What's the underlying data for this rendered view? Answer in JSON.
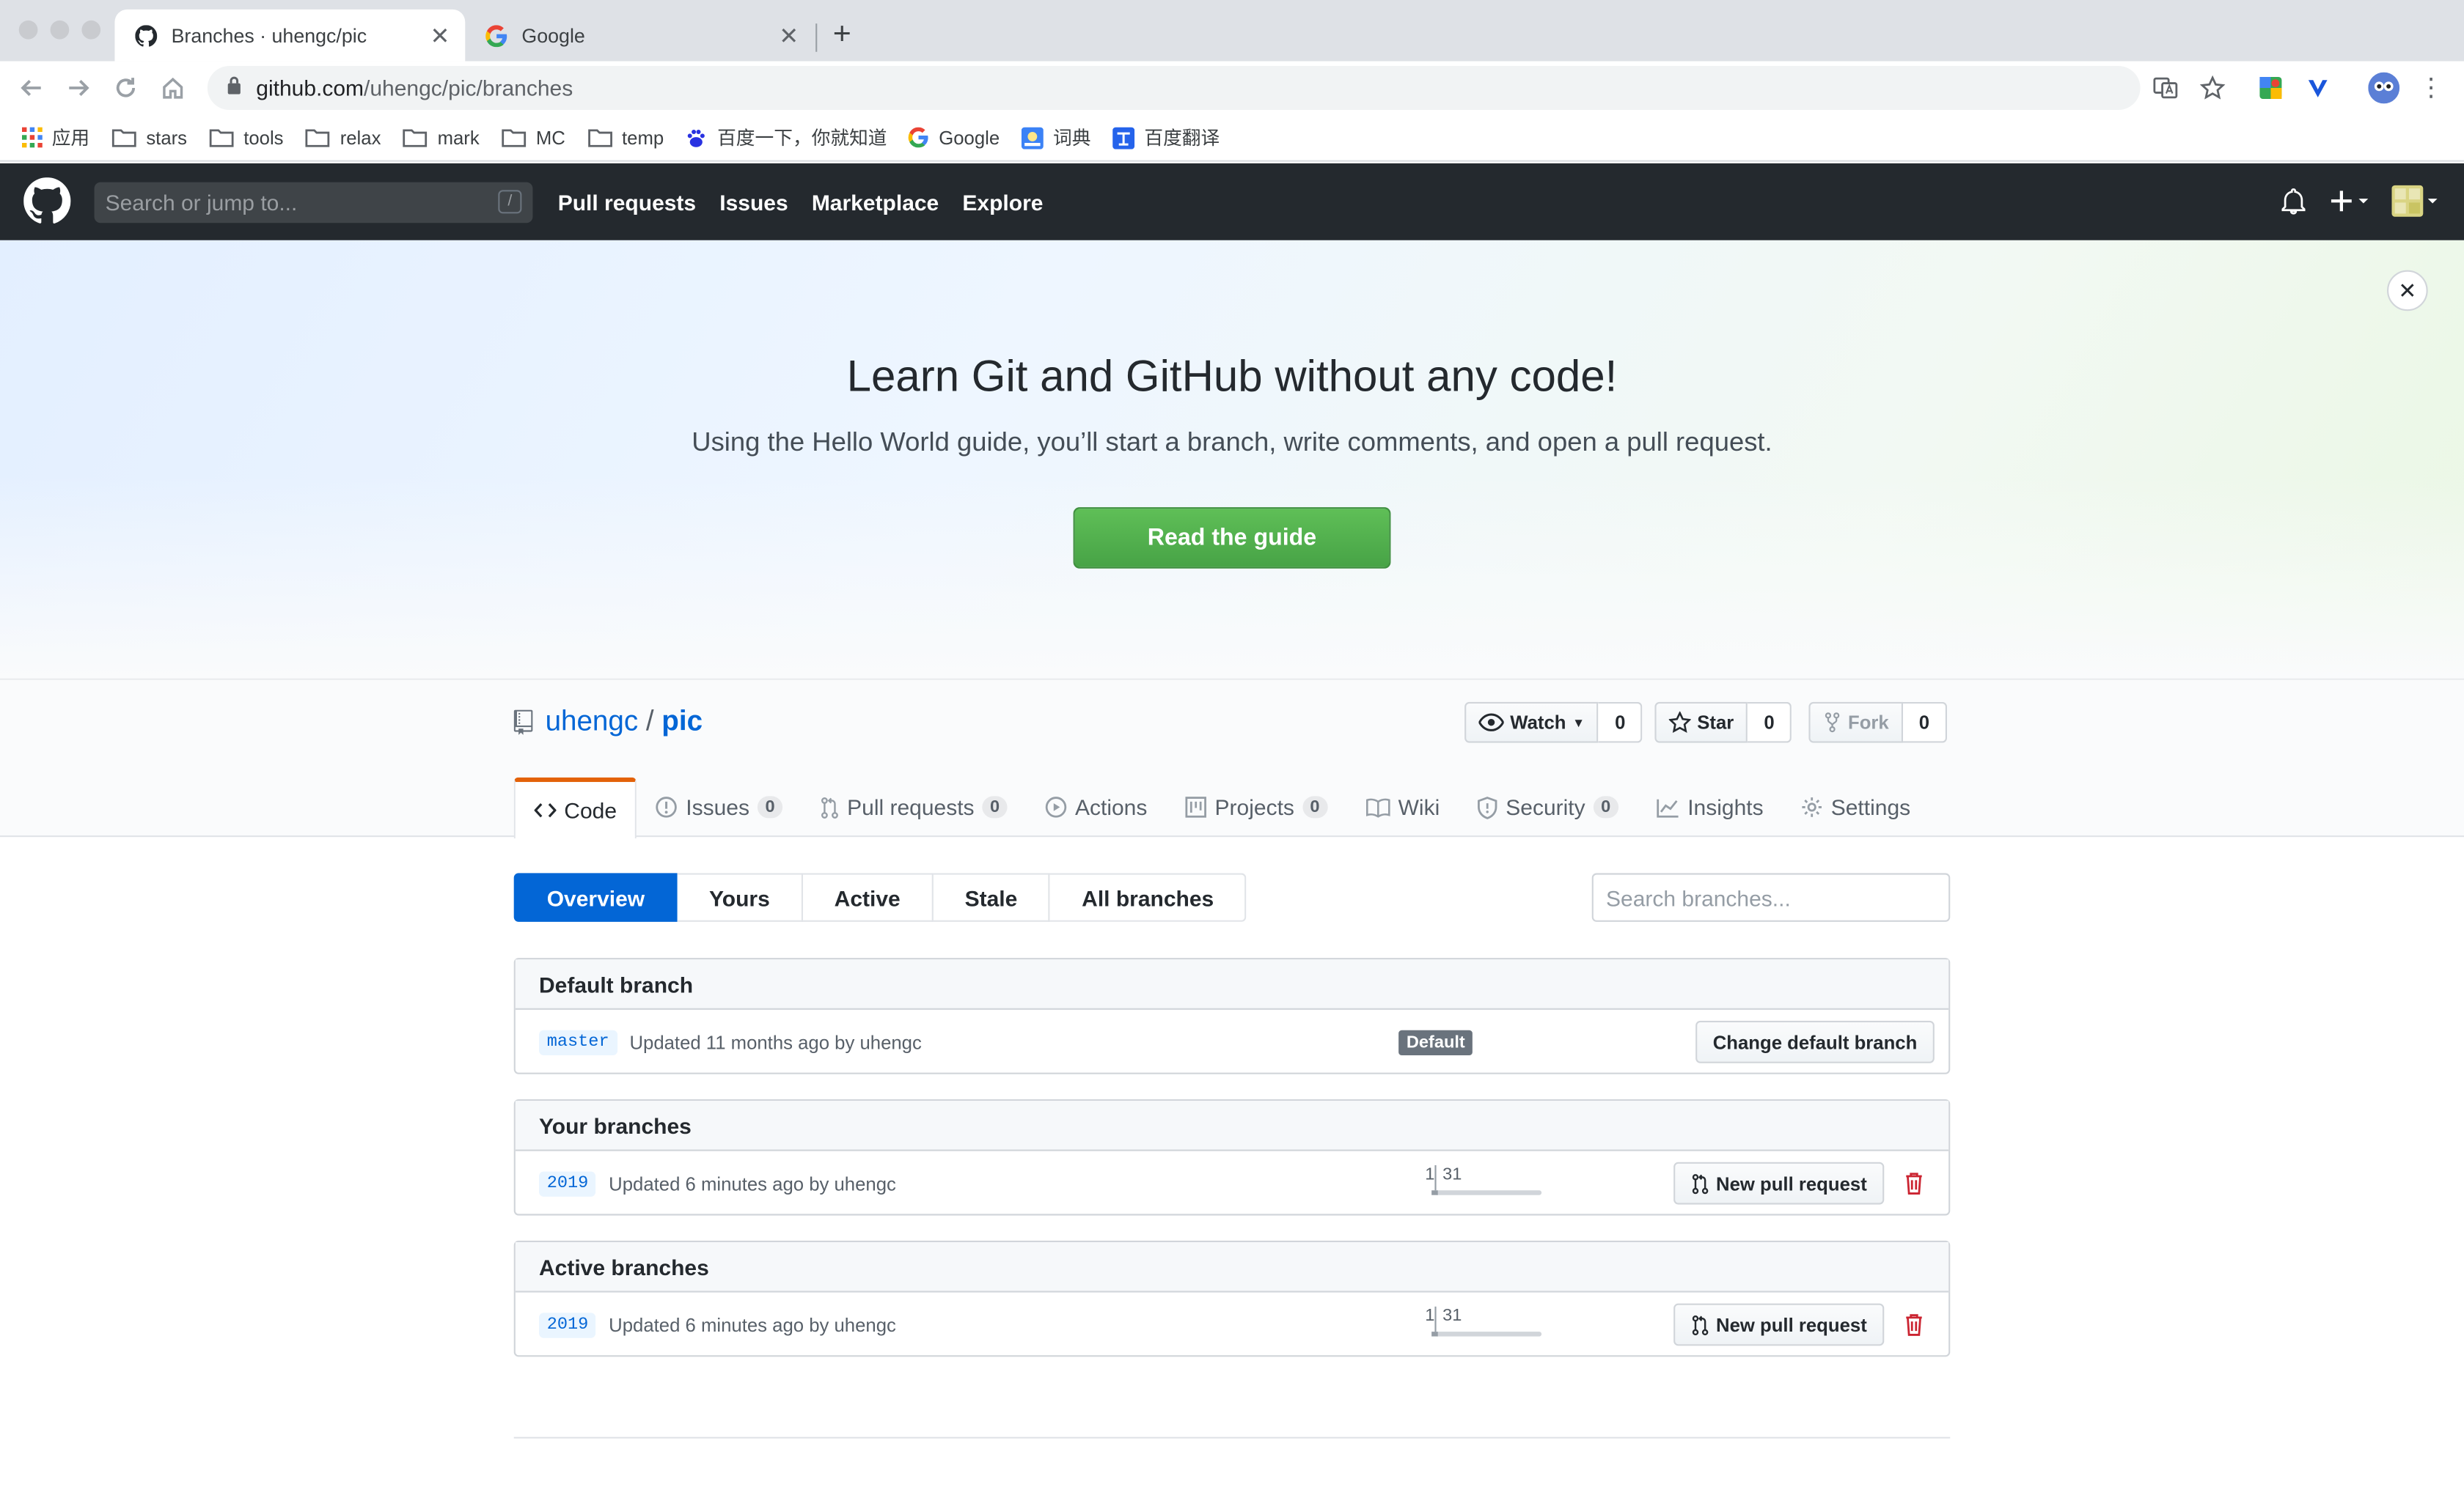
{
  "browser": {
    "tabs": [
      {
        "title": "Branches · uhengc/pic",
        "active": true,
        "icon": "github-icon"
      },
      {
        "title": "Google",
        "active": false,
        "icon": "google-icon"
      }
    ],
    "url": {
      "host": "github.com",
      "path": "/uhengc/pic/branches"
    },
    "bookmarks": [
      {
        "label": "应用",
        "icon": "apps-grid-icon"
      },
      {
        "label": "stars",
        "icon": "folder-icon"
      },
      {
        "label": "tools",
        "icon": "folder-icon"
      },
      {
        "label": "relax",
        "icon": "folder-icon"
      },
      {
        "label": "mark",
        "icon": "folder-icon"
      },
      {
        "label": "MC",
        "icon": "folder-icon"
      },
      {
        "label": "temp",
        "icon": "folder-icon"
      },
      {
        "label": "百度一下，你就知道",
        "icon": "baidu-icon"
      },
      {
        "label": "Google",
        "icon": "google-icon"
      },
      {
        "label": "词典",
        "icon": "dictionary-icon"
      },
      {
        "label": "百度翻译",
        "icon": "baidu-translate-icon"
      }
    ]
  },
  "github": {
    "search_placeholder": "Search or jump to...",
    "slash_key": "/",
    "nav": [
      "Pull requests",
      "Issues",
      "Marketplace",
      "Explore"
    ]
  },
  "banner": {
    "title": "Learn Git and GitHub without any code!",
    "subtitle": "Using the Hello World guide, you’ll start a branch, write comments, and open a pull request.",
    "button": "Read the guide",
    "close": "✕"
  },
  "repo": {
    "owner": "uhengc",
    "separator": "/",
    "name": "pic",
    "watch": {
      "label": "Watch",
      "count": "0"
    },
    "star": {
      "label": "Star",
      "count": "0"
    },
    "fork": {
      "label": "Fork",
      "count": "0"
    },
    "tabs": [
      {
        "label": "Code",
        "icon": "code-icon",
        "count": null,
        "selected": true
      },
      {
        "label": "Issues",
        "icon": "issue-icon",
        "count": "0"
      },
      {
        "label": "Pull requests",
        "icon": "pull-request-icon",
        "count": "0"
      },
      {
        "label": "Actions",
        "icon": "play-icon",
        "count": null
      },
      {
        "label": "Projects",
        "icon": "project-icon",
        "count": "0"
      },
      {
        "label": "Wiki",
        "icon": "book-icon",
        "count": null
      },
      {
        "label": "Security",
        "icon": "shield-icon",
        "count": "0"
      },
      {
        "label": "Insights",
        "icon": "graph-icon",
        "count": null
      },
      {
        "label": "Settings",
        "icon": "gear-icon",
        "count": null
      }
    ]
  },
  "branches": {
    "filters": [
      "Overview",
      "Yours",
      "Active",
      "Stale",
      "All branches"
    ],
    "selected_filter": "Overview",
    "search_placeholder": "Search branches...",
    "default_section": {
      "title": "Default branch",
      "branch": "master",
      "updated": "Updated 11 months ago by uhengc",
      "label": "Default",
      "button": "Change default branch"
    },
    "yours_section": {
      "title": "Your branches",
      "branch": "2019",
      "updated": "Updated 6 minutes ago by uhengc",
      "behind": "1",
      "ahead": "31",
      "button": "New pull request"
    },
    "active_section": {
      "title": "Active branches",
      "branch": "2019",
      "updated": "Updated 6 minutes ago by uhengc",
      "behind": "1",
      "ahead": "31",
      "button": "New pull request"
    }
  },
  "colors": {
    "header_bg": "#24292e",
    "link": "#0366d6",
    "selected_tab_accent": "#e36209",
    "primary_green": "#4ea64c",
    "danger": "#cb2431"
  }
}
